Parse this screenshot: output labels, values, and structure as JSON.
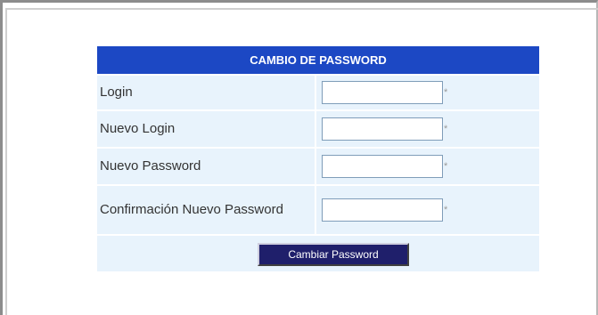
{
  "form": {
    "title": "CAMBIO DE PASSWORD",
    "fields": [
      {
        "label": "Login",
        "value": "",
        "required_mark": "*"
      },
      {
        "label": "Nuevo Login",
        "value": "",
        "required_mark": "*"
      },
      {
        "label": "Nuevo Password",
        "value": "",
        "required_mark": "*"
      },
      {
        "label": "Confirmación Nuevo Password",
        "value": "",
        "required_mark": "*"
      }
    ],
    "submit_label": "Cambiar Password"
  },
  "colors": {
    "header_bg": "#1c48c4",
    "row_bg": "#e8f3fc",
    "button_bg": "#1f1f6b"
  }
}
